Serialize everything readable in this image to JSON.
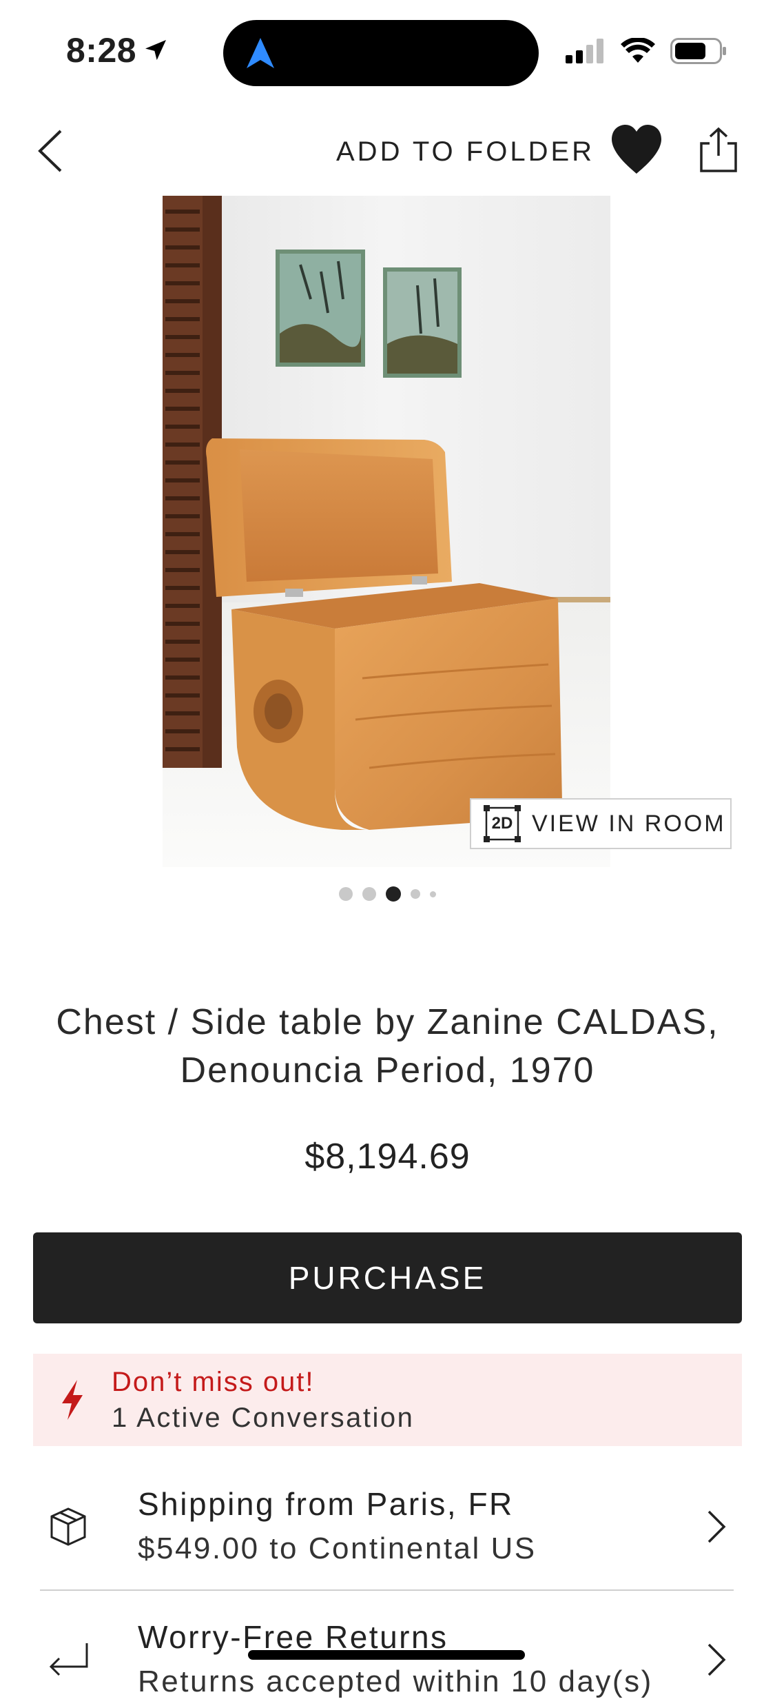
{
  "status_bar": {
    "time": "8:28"
  },
  "toolbar": {
    "add_to_folder": "ADD TO FOLDER"
  },
  "image": {
    "view_in_room_badge": "2D",
    "view_in_room_label": "VIEW IN ROOM",
    "carousel_total": 5,
    "carousel_active": 3
  },
  "product": {
    "title_line1": "Chest / Side table by Zanine CALDAS,",
    "title_line2": "Denouncia Period, 1970",
    "price": "$8,194.69"
  },
  "purchase_label": "PURCHASE",
  "alert": {
    "heading": "Don’t miss out!",
    "detail": "1 Active Conversation"
  },
  "shipping": {
    "line1": "Shipping from Paris, FR",
    "line2": "$549.00 to Continental US"
  },
  "returns": {
    "line1": "Worry-Free Returns",
    "line2": "Returns accepted within 10 day(s)"
  },
  "colors": {
    "alert_red": "#c41a1a",
    "alert_bg": "#fcecec",
    "button_bg": "#222222"
  }
}
